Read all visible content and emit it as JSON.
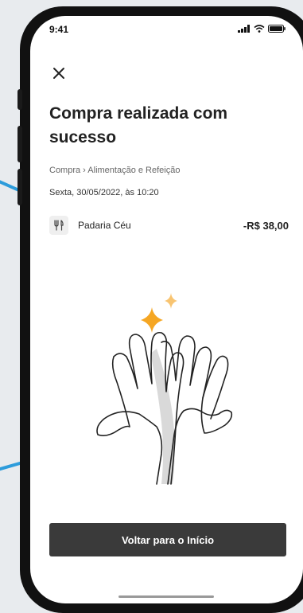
{
  "status_bar": {
    "time": "9:41",
    "icons": [
      "signal-icon",
      "wifi-icon",
      "battery-icon"
    ]
  },
  "header": {
    "close_icon": "close-icon"
  },
  "receipt": {
    "title": "Compra realizada com sucesso",
    "breadcrumb": "Compra › Alimentação e Refeição",
    "datetime": "Sexta, 30/05/2022, às 10:20",
    "merchant_icon": "cutlery-icon",
    "merchant": "Padaria Céu",
    "amount": "-R$ 38,00"
  },
  "illustration": {
    "name": "high-five-illustration",
    "sparkle_color": "#f5a623"
  },
  "actions": {
    "primary_label": "Voltar para o Início"
  },
  "colors": {
    "accent_line": "#2d9cdb",
    "button_bg": "#3a3a3a"
  }
}
